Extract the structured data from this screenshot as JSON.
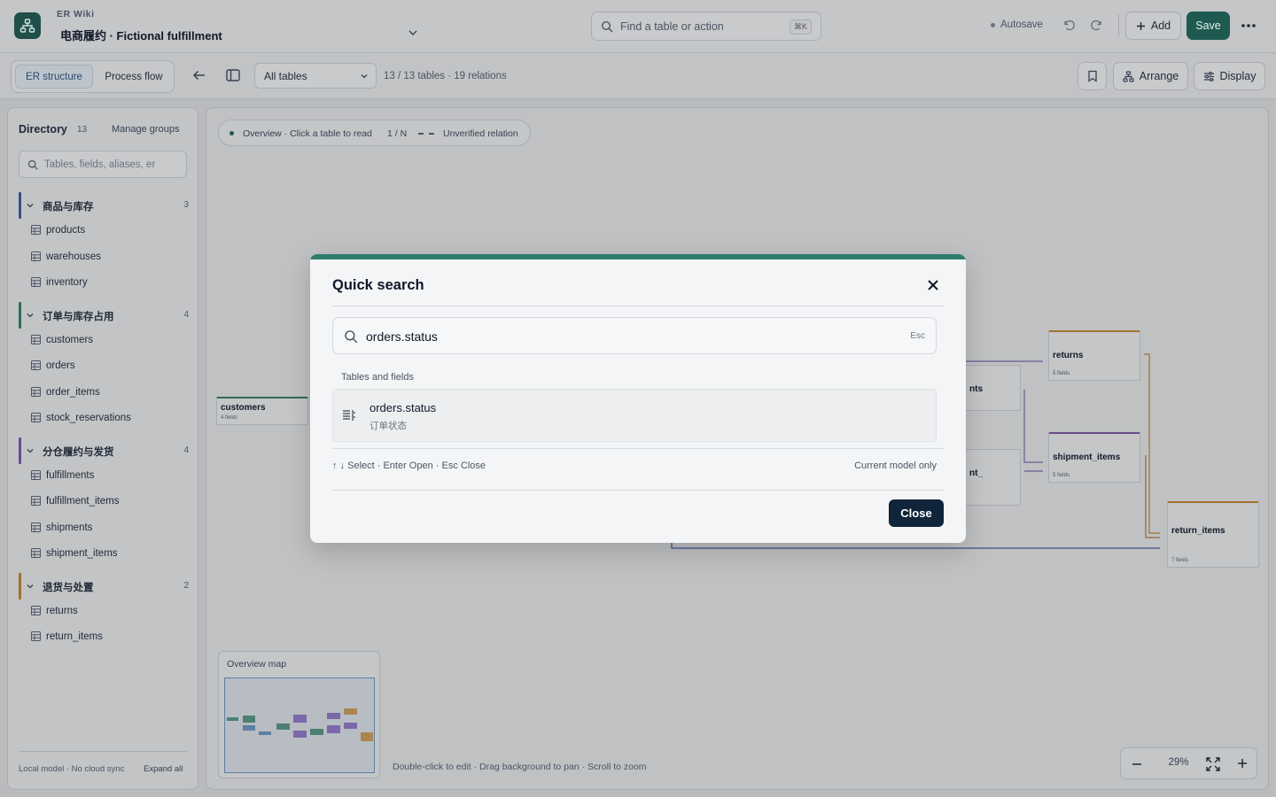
{
  "header": {
    "app_name": "ER Wiki",
    "model_title": "电商履约 · Fictional fulfillment",
    "search_placeholder": "Find a table or action",
    "search_shortcut": "⌘K",
    "autosave_label": "Autosave",
    "add_label": "Add",
    "save_label": "Save"
  },
  "toolbar": {
    "tabs": [
      {
        "label": "ER structure",
        "active": true
      },
      {
        "label": "Process flow",
        "active": false
      }
    ],
    "table_filter": "All tables",
    "count_text": "13 / 13 tables · 19 relations",
    "arrange_label": "Arrange",
    "display_label": "Display"
  },
  "sidebar": {
    "title": "Directory",
    "count": "13",
    "manage_label": "Manage groups",
    "search_placeholder": "Tables, fields, aliases, er",
    "groups": [
      {
        "name": "商品与库存",
        "count": "3",
        "color": "#3b4f86",
        "items": [
          "products",
          "warehouses",
          "inventory"
        ]
      },
      {
        "name": "订单与库存占用",
        "count": "4",
        "color": "#2f6b58",
        "items": [
          "customers",
          "orders",
          "order_items",
          "stock_reservations"
        ]
      },
      {
        "name": "分仓履约与发货",
        "count": "4",
        "color": "#6a4b8c",
        "items": [
          "fulfillments",
          "fulfillment_items",
          "shipments",
          "shipment_items"
        ]
      },
      {
        "name": "退货与处置",
        "count": "2",
        "color": "#a1722f",
        "items": [
          "returns",
          "return_items"
        ]
      }
    ],
    "footer_left": "Local model · No cloud sync",
    "footer_right": "Expand all"
  },
  "canvas": {
    "legend_text": "Overview · Click a table to read",
    "legend_cardinality": "1 / N",
    "legend_dashed": "Unverified relation",
    "tables": [
      {
        "name": "customers",
        "fields": "4 fields"
      },
      {
        "name": "returns",
        "fields": "5 fields"
      },
      {
        "name": "shipment_items",
        "fields": "5 fields"
      },
      {
        "name": "return_items",
        "fields": "7 fields"
      },
      {
        "name": "nts",
        "fields": ""
      },
      {
        "name": "nt_",
        "fields": ""
      }
    ],
    "overview_title": "Overview map",
    "hint": "Double-click to edit · Drag background to pan · Scroll to zoom",
    "zoom": "29%"
  },
  "modal": {
    "title": "Quick search",
    "query": "orders.status",
    "esc_label": "Esc",
    "section": "Tables and fields",
    "result_title": "orders.status",
    "result_subtitle": "订单状态",
    "hint_left": "↑ ↓ Select · Enter Open · Esc Close",
    "hint_right": "Current model only",
    "close_label": "Close",
    "accent": "#2f7d6c"
  }
}
